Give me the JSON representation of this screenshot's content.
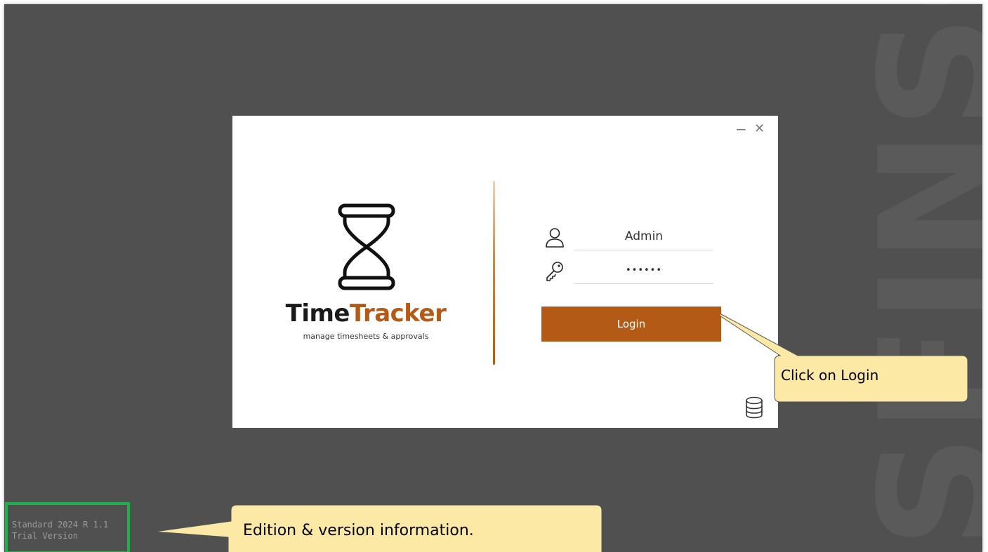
{
  "watermark": {
    "text": "SFINSO"
  },
  "dialog": {
    "window_controls": {
      "minimize": "−",
      "close": "✕"
    },
    "logo": {
      "brand_part1": "Time",
      "brand_part2": "Tracker",
      "tagline": "manage timesheets & approvals",
      "icon": "hourglass-icon"
    },
    "form": {
      "username": {
        "value": "Admin",
        "icon": "user-icon"
      },
      "password": {
        "value": "••••••",
        "icon": "key-icon"
      },
      "login_label": "Login"
    },
    "database_icon": "database-icon"
  },
  "callouts": {
    "login": "Click on Login",
    "version": "Edition & version information."
  },
  "version": {
    "edition": "Standard 2024 R 1.1",
    "license": "Trial Version"
  },
  "colors": {
    "accent": "#b35a16",
    "background": "#505050",
    "callout_fill": "#fde9a6",
    "highlight_border": "#1fb04c"
  }
}
